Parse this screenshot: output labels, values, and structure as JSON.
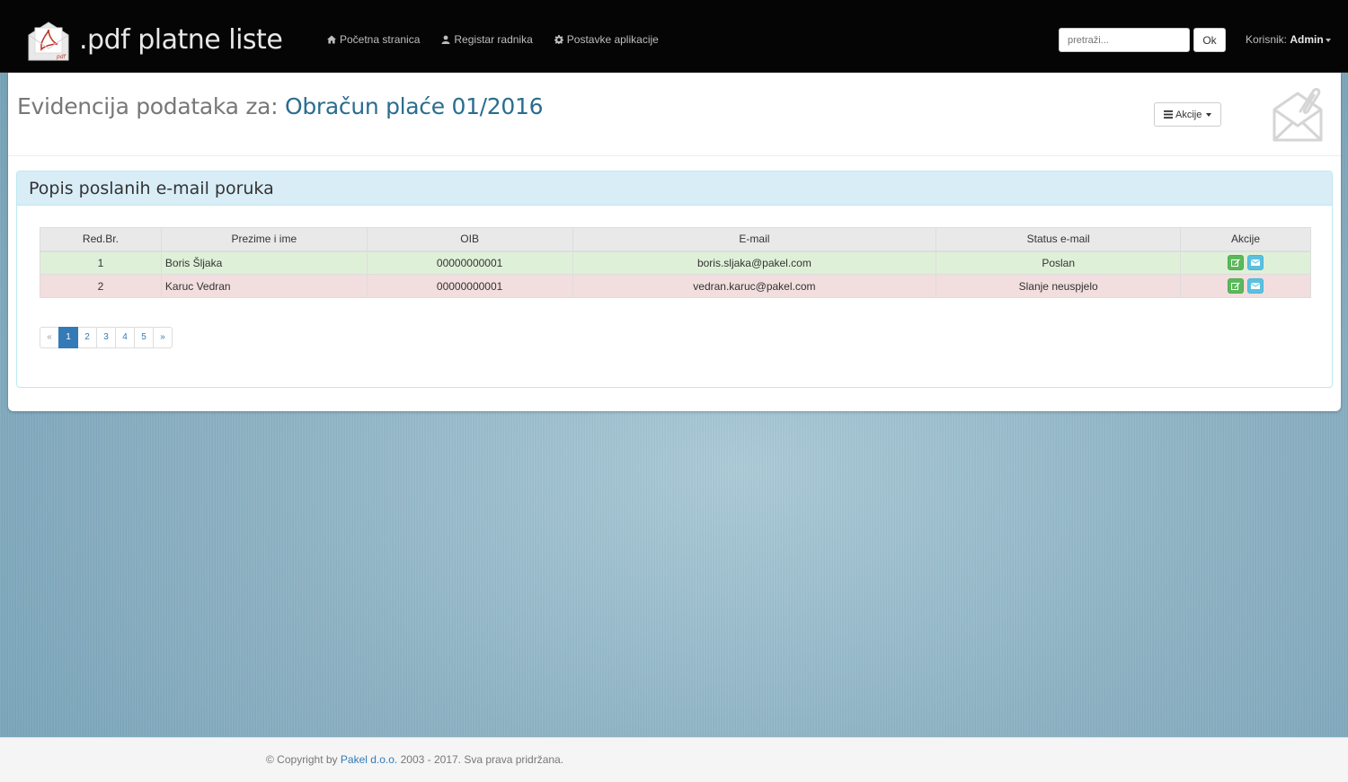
{
  "navbar": {
    "brand": ".pdf platne liste",
    "brand_icon_label": "pdf",
    "links": [
      {
        "label": "Početna stranica",
        "icon": "home-icon"
      },
      {
        "label": "Registar radnika",
        "icon": "user-icon"
      },
      {
        "label": "Postavke aplikacije",
        "icon": "gear-icon"
      }
    ],
    "search": {
      "placeholder": "pretraži...",
      "value": "",
      "button": "Ok"
    },
    "user": {
      "prefix": "Korisnik:",
      "name": "Admin"
    }
  },
  "header": {
    "title_prefix": "Evidencija podataka za:",
    "title_highlight": "Obračun plaće 01/2016",
    "actions_label": "Akcije"
  },
  "panel": {
    "title": "Popis poslanih e-mail poruka",
    "columns": [
      "Red.Br.",
      "Prezime i ime",
      "OIB",
      "E-mail",
      "Status e-mail",
      "Akcije"
    ],
    "rows": [
      {
        "no": "1",
        "name": "Boris Šljaka",
        "oib": "00000000001",
        "email": "boris.sljaka@pakel.com",
        "status": "Poslan",
        "state": "success"
      },
      {
        "no": "2",
        "name": "Karuc Vedran",
        "oib": "00000000001",
        "email": "vedran.karuc@pakel.com",
        "status": "Slanje neuspjelo",
        "state": "danger"
      }
    ],
    "pagination": {
      "prev": "«",
      "pages": [
        "1",
        "2",
        "3",
        "4",
        "5"
      ],
      "next": "»",
      "active": "1"
    }
  },
  "footer": {
    "prefix": "© Copyright by",
    "company": "Pakel d.o.o.",
    "suffix": "2003 - 2017. Sva prava pridržana."
  },
  "colors": {
    "navbar_bg": "#050505",
    "title_accent": "#2a6d8f",
    "panel_heading": "#d9edf7",
    "row_success": "#dff0d8",
    "row_danger": "#f2dede",
    "btn_edit": "#5cb85c",
    "btn_mail": "#5bc0de",
    "page_active": "#337ab7"
  }
}
